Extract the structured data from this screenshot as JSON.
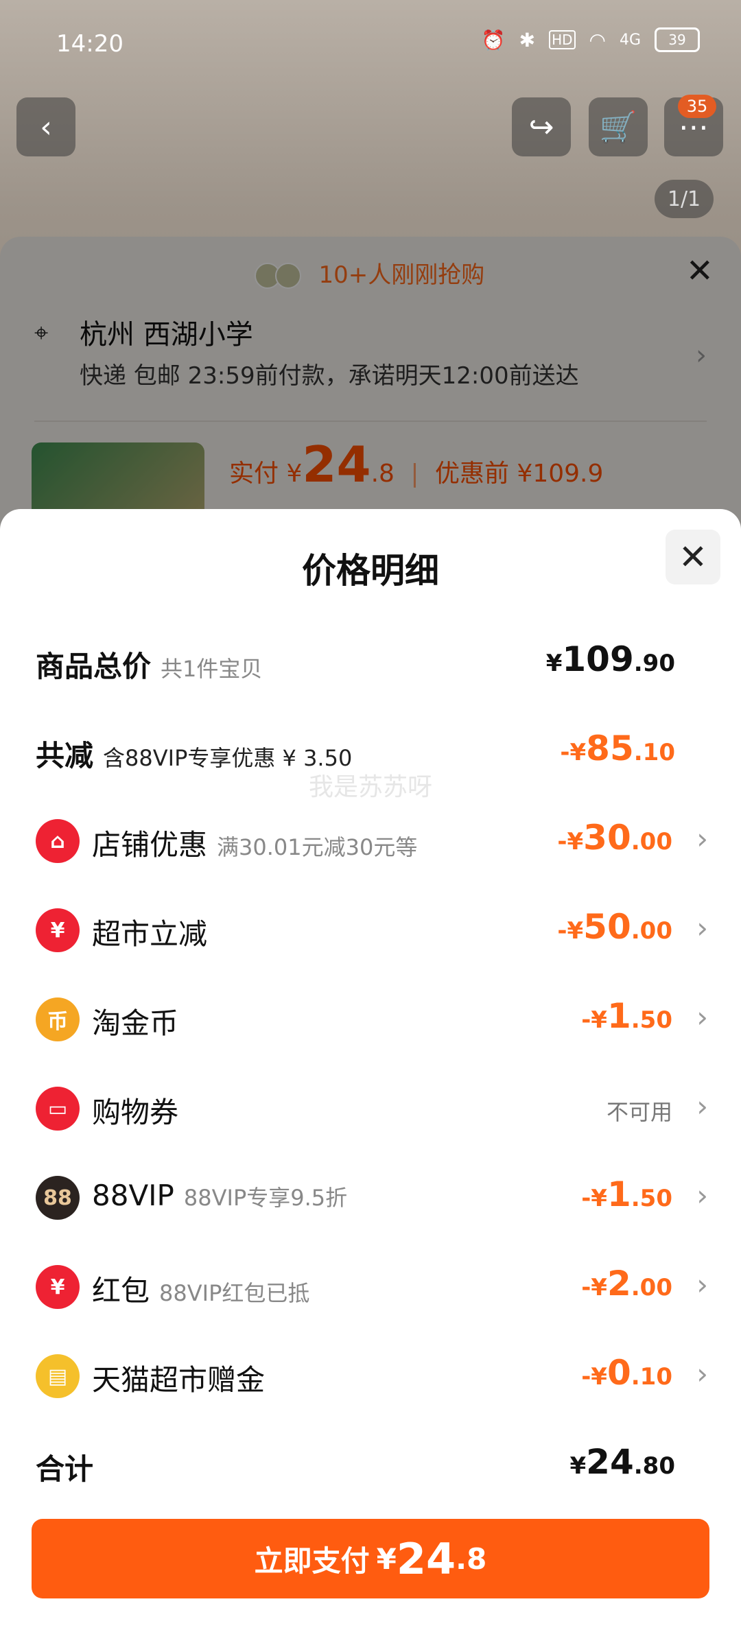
{
  "status_bar": {
    "time": "14:20",
    "network": "4G",
    "hd": "HD",
    "battery": "39"
  },
  "background": {
    "cart_badge": "35",
    "image_pager": "1/1"
  },
  "order_sheet": {
    "promo": "10+人刚刚抢购",
    "address": "杭州 西湖小学",
    "delivery": "快递 包邮 23:59前付款，承诺明天12:00前送达",
    "paid_label": "实付",
    "paid_currency": "¥",
    "paid_int": "24",
    "paid_dec": ".8",
    "before_label": "优惠前 ¥109.9"
  },
  "price_detail": {
    "title": "价格明细",
    "total_goods": {
      "label": "商品总价",
      "sub": "共1件宝贝",
      "currency": "¥",
      "int": "109",
      "dec": ".90"
    },
    "total_discount": {
      "label": "共减",
      "sub": "含88VIP专享优惠 ¥ 3.50",
      "prefix": "-¥",
      "int": "85",
      "dec": ".10"
    },
    "items": [
      {
        "label": "店铺优惠",
        "sub": "满30.01元减30元等",
        "prefix": "-¥",
        "int": "30",
        "dec": ".00",
        "icon": "store-icon",
        "color": "#ee2233"
      },
      {
        "label": "超市立减",
        "sub": "",
        "prefix": "-¥",
        "int": "50",
        "dec": ".00",
        "icon": "yuan-coin-icon",
        "color": "#ee2233"
      },
      {
        "label": "淘金币",
        "sub": "",
        "prefix": "-¥",
        "int": "1",
        "dec": ".50",
        "icon": "gold-coin-icon",
        "color": "#f5a623"
      },
      {
        "label": "购物券",
        "sub": "",
        "status": "不可用",
        "icon": "coupon-icon",
        "color": "#ee2233"
      },
      {
        "label": "88VIP",
        "sub": "88VIP专享9.5折",
        "prefix": "-¥",
        "int": "1",
        "dec": ".50",
        "icon": "vip-88-icon",
        "color": "#2b2320"
      },
      {
        "label": "红包",
        "sub": "88VIP红包已抵",
        "prefix": "-¥",
        "int": "2",
        "dec": ".00",
        "icon": "red-envelope-icon",
        "color": "#ee2233"
      },
      {
        "label": "天猫超市赠金",
        "sub": "",
        "prefix": "-¥",
        "int": "0",
        "dec": ".10",
        "icon": "gift-money-icon",
        "color": "#f5c02b"
      }
    ],
    "watermark": "我是苏苏呀",
    "total": {
      "label": "合计",
      "currency": "¥",
      "int": "24",
      "dec": ".80"
    },
    "pay_button": {
      "label": "立即支付",
      "currency": "¥",
      "int": "24",
      "dec": ".8"
    }
  }
}
